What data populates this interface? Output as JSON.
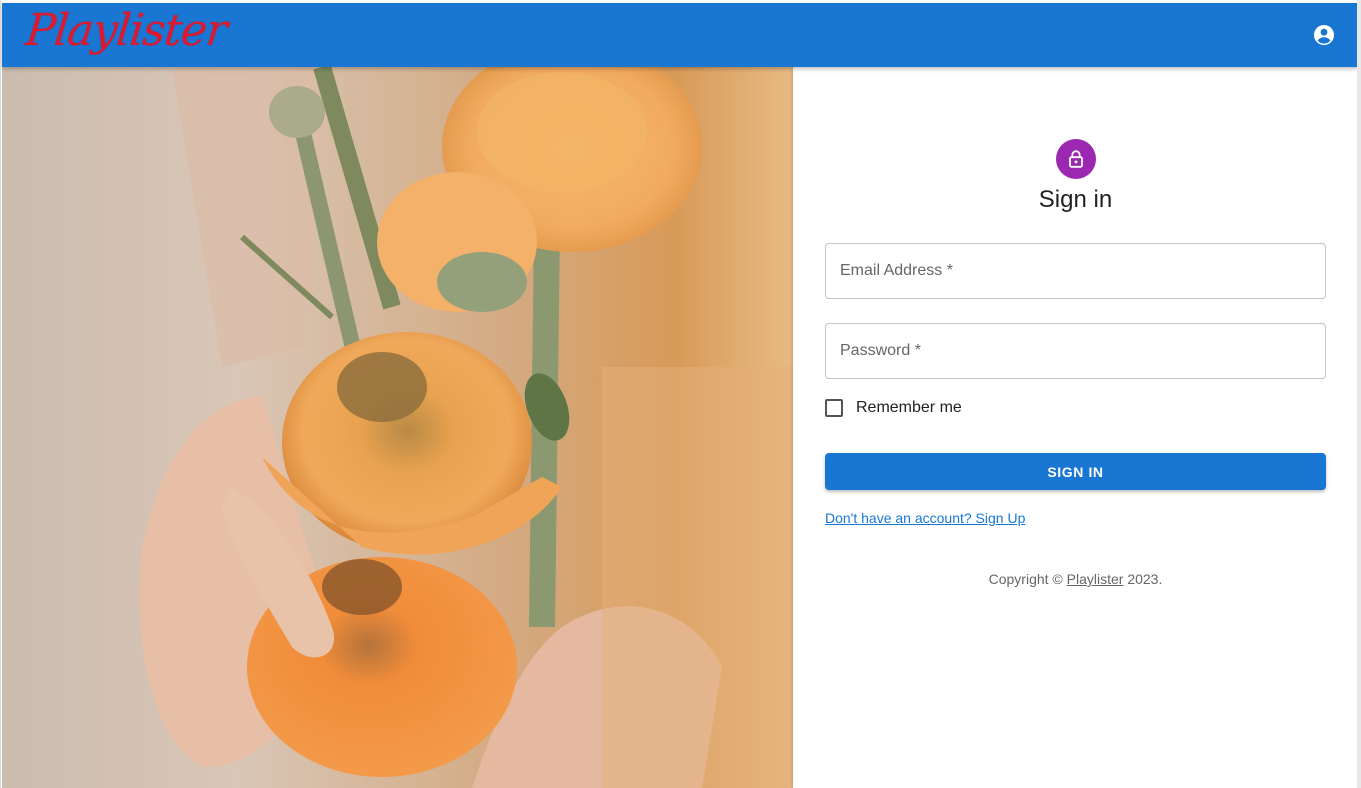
{
  "header": {
    "logo_text": "Playlister",
    "account_icon": "account-circle-icon",
    "background_color": "#1976d2",
    "logo_color": "#e0182d"
  },
  "hero": {
    "image": "orange ranunculus flowers held in hands"
  },
  "signin": {
    "avatar_icon": "lock-icon",
    "avatar_color": "#9c27b0",
    "title": "Sign in",
    "email_placeholder": "Email Address *",
    "password_placeholder": "Password *",
    "remember_label": "Remember me",
    "remember_checked": false,
    "submit_label": "SIGN IN",
    "signup_link": "Don't have an account? Sign Up",
    "copyright_prefix": "Copyright © ",
    "copyright_link": "Playlister",
    "copyright_suffix": " 2023."
  }
}
